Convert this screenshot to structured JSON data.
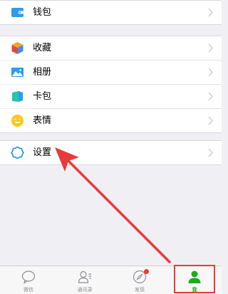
{
  "menu": {
    "wallet": "钱包",
    "favorites": "收藏",
    "album": "相册",
    "cards": "卡包",
    "stickers": "表情",
    "settings": "设置"
  },
  "tabbar": {
    "tabs": [
      {
        "label": "微信",
        "icon": "chat-bubble-icon"
      },
      {
        "label": "通讯录",
        "icon": "contacts-icon"
      },
      {
        "label": "发现",
        "icon": "compass-icon"
      },
      {
        "label": "我",
        "icon": "person-icon"
      }
    ],
    "active_index": 3
  },
  "colors": {
    "background": "#EFEFF4",
    "accent_green": "#1AAD19",
    "annotation_red": "#E83A3A",
    "badge_red": "#F43530"
  }
}
